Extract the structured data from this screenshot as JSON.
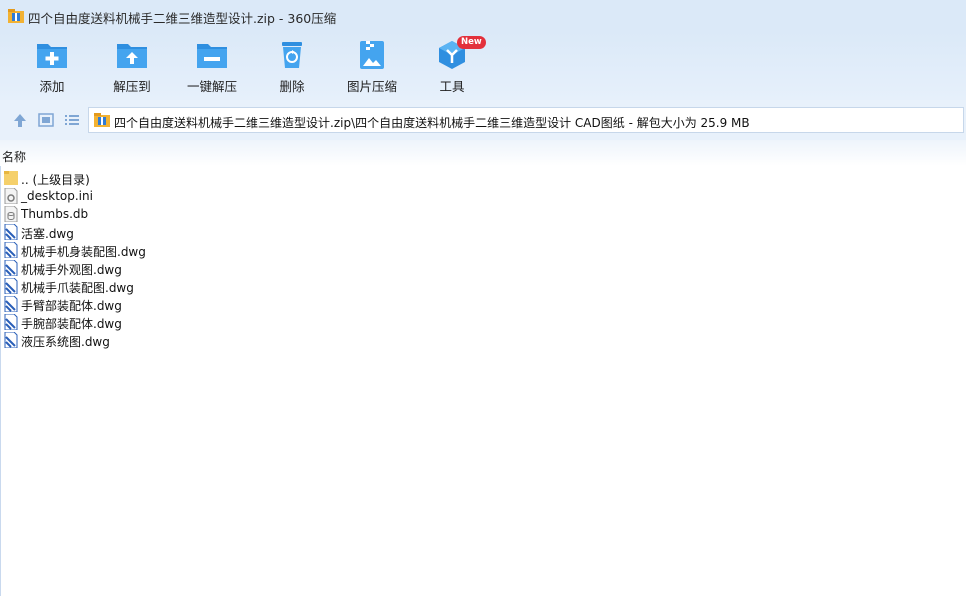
{
  "window": {
    "title": "四个自由度送料机械手二维三维造型设计.zip - 360压缩"
  },
  "toolbar": {
    "buttons": [
      {
        "label": "添加",
        "icon": "add-folder-icon"
      },
      {
        "label": "解压到",
        "icon": "extract-to-icon"
      },
      {
        "label": "一键解压",
        "icon": "one-click-extract-icon"
      },
      {
        "label": "删除",
        "icon": "recycle-bin-icon"
      },
      {
        "label": "图片压缩",
        "icon": "image-compress-icon"
      },
      {
        "label": "工具",
        "icon": "tools-cube-icon",
        "badge": "New"
      }
    ]
  },
  "nav": {
    "path": "四个自由度送料机械手二维三维造型设计.zip\\四个自由度送料机械手二维三维造型设计 CAD图纸 - 解包大小为 25.9 MB"
  },
  "list": {
    "column_name": "名称",
    "items": [
      {
        "name": ".. (上级目录)",
        "type": "folder"
      },
      {
        "name": "_desktop.ini",
        "type": "ini"
      },
      {
        "name": "Thumbs.db",
        "type": "db"
      },
      {
        "name": "活塞.dwg",
        "type": "dwg"
      },
      {
        "name": "机械手机身装配图.dwg",
        "type": "dwg"
      },
      {
        "name": "机械手外观图.dwg",
        "type": "dwg"
      },
      {
        "name": "机械手爪装配图.dwg",
        "type": "dwg"
      },
      {
        "name": "手臂部装配体.dwg",
        "type": "dwg"
      },
      {
        "name": "手腕部装配体.dwg",
        "type": "dwg"
      },
      {
        "name": "液压系统图.dwg",
        "type": "dwg"
      }
    ]
  },
  "colors": {
    "accent": "#2f8fe0",
    "toolbar_bg": "#dbe9f8",
    "badge": "#e3303b"
  }
}
